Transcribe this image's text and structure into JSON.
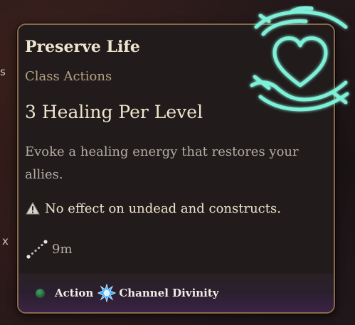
{
  "background": {
    "left_edge_fragments": [
      "s",
      "x"
    ]
  },
  "tooltip": {
    "title": "Preserve Life",
    "category": "Class Actions",
    "headline": "3 Healing Per Level",
    "description": "Evoke a healing energy that restores your allies.",
    "warning": {
      "icon": "warning-triangle-icon",
      "text": "No effect on undead and constructs."
    },
    "range": {
      "icon": "range-dotted-line-icon",
      "value": "9m"
    },
    "cost": [
      {
        "icon": "action-dot-icon",
        "label": "Action",
        "color": "#2f7d4a"
      },
      {
        "icon": "channel-divinity-icon",
        "label": "Channel Divinity",
        "color": "#6fc6ff"
      }
    ],
    "spell_icon": "healing-hands-heart-icon",
    "colors": {
      "border": "#8a6a4c",
      "title": "#efe4cf",
      "category": "#b8a182",
      "glow": "#7ff0d8"
    }
  }
}
